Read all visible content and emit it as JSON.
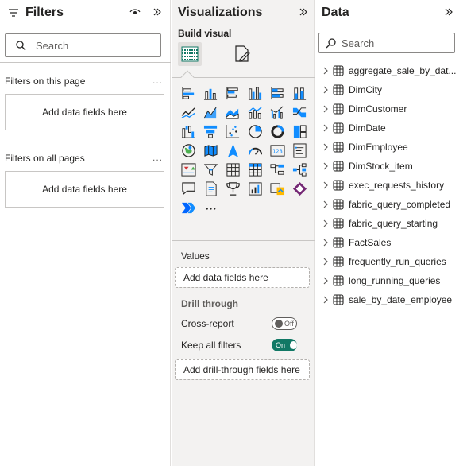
{
  "filters": {
    "title": "Filters",
    "search_placeholder": "Search",
    "section_page": "Filters on this page",
    "section_all": "Filters on all pages",
    "add_fields": "Add data fields here",
    "more": "..."
  },
  "visualizations": {
    "title": "Visualizations",
    "build_label": "Build visual",
    "more_label": "...",
    "values_label": "Values",
    "values_placeholder": "Add data fields here",
    "drill_title": "Drill through",
    "cross_report_label": "Cross-report",
    "cross_report_state": "Off",
    "keep_filters_label": "Keep all filters",
    "keep_filters_state": "On",
    "drill_placeholder": "Add drill-through fields here",
    "icons": [
      "stacked-bar-chart-icon",
      "stacked-column-chart-icon",
      "clustered-bar-chart-icon",
      "clustered-column-chart-icon",
      "100-stacked-bar-chart-icon",
      "100-stacked-column-chart-icon",
      "line-chart-icon",
      "area-chart-icon",
      "stacked-area-chart-icon",
      "line-and-stacked-column-chart-icon",
      "line-and-clustered-column-chart-icon",
      "ribbon-chart-icon",
      "waterfall-chart-icon",
      "funnel-chart-icon",
      "scatter-chart-icon",
      "pie-chart-icon",
      "donut-chart-icon",
      "treemap-icon",
      "map-icon",
      "filled-map-icon",
      "azure-map-icon",
      "gauge-icon",
      "card-icon",
      "multi-row-card-icon",
      "kpi-icon",
      "slicer-icon",
      "table-icon",
      "matrix-icon",
      "key-influencers-icon",
      "decomposition-tree-icon",
      "qa-icon",
      "paginated-report-icon",
      "metrics-icon",
      "r-visual-icon",
      "python-visual-icon",
      "power-apps-icon",
      "power-automate-icon",
      "more-visuals-icon"
    ]
  },
  "data_pane": {
    "title": "Data",
    "search_placeholder": "Search",
    "items": [
      "aggregate_sale_by_dat...",
      "DimCity",
      "DimCustomer",
      "DimDate",
      "DimEmployee",
      "DimStock_item",
      "exec_requests_history",
      "fabric_query_completed",
      "fabric_query_starting",
      "FactSales",
      "frequently_run_queries",
      "long_running_queries",
      "sale_by_date_employee"
    ]
  },
  "colors": {
    "accent_teal": "#117865",
    "chart_blue": "#118dff",
    "icon_dark": "#252423",
    "pane_bg": "#f3f2f1"
  }
}
